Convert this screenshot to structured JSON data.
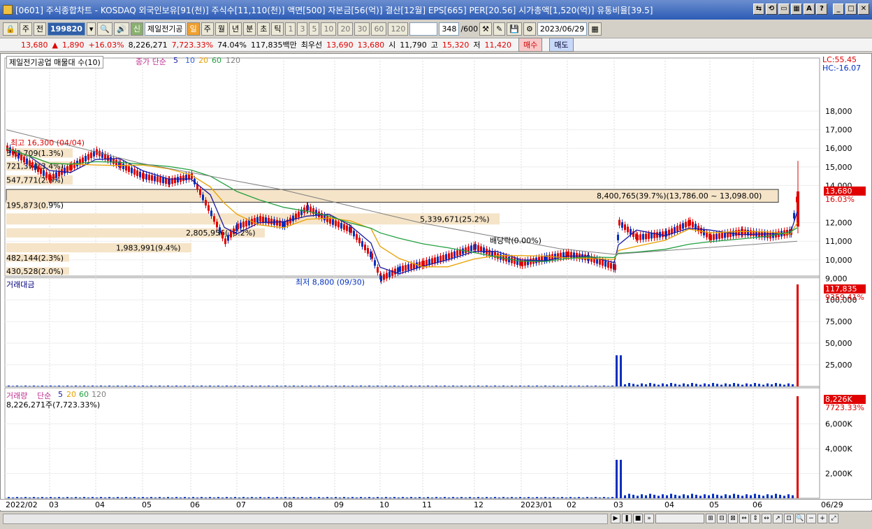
{
  "window": {
    "title": "[0601] 주식종합차트 - KOSDAQ 외국인보유[91(천)] 주식수[11,110(천)] 액면[500] 자본금[56(억)] 결산[12월] EPS[665] PER[20.56] 시가총액[1,520(억)] 유통비율[39.5]",
    "buttons": [
      "⇆",
      "⟲",
      "▭",
      "▦",
      "A",
      "?",
      "_",
      "□",
      "✕"
    ]
  },
  "toolbar": {
    "period_select": "주",
    "prev_label": "전",
    "code": "199820",
    "name_badge": "신",
    "stock_name": "제일전기공",
    "period_tabs": [
      "일",
      "주",
      "월",
      "년",
      "분",
      "초",
      "틱"
    ],
    "active_tab": "일",
    "intervals": [
      "1",
      "3",
      "5",
      "10",
      "20",
      "30",
      "60",
      "120"
    ],
    "count": "348",
    "count_total": "/600",
    "date": "2023/06/29"
  },
  "price_bar": {
    "price": "13,680",
    "arrow": "▲",
    "change": "1,890",
    "change_pct": "+16.03%",
    "volume": "8,226,271",
    "volume_pct": "7,723.33%",
    "turnover": "74.04%",
    "amount": "117,835백만",
    "bid_label": "최우선",
    "bid1": "13,690",
    "bid2": "13,680",
    "open_label": "시",
    "open": "11,790",
    "high_label": "고",
    "high": "15,320",
    "low_label": "저",
    "low": "11,420",
    "buy": "매수",
    "sell": "매도"
  },
  "price_panel": {
    "title": "제일전기공업 매물대 수(10)",
    "ma_label": "종가 단순",
    "ma_periods": [
      "5",
      "10",
      "20",
      "60",
      "120"
    ],
    "lc": "LC:55.45",
    "hc": "HC:-16.07",
    "y_ticks": [
      "18,000",
      "17,000",
      "16,000",
      "15,000",
      "14,000",
      "12,000",
      "11,000",
      "10,000",
      "9,000"
    ],
    "current_price_tag": "13,680",
    "current_pct_tag": "16.03%",
    "high_marker": "최고 16,300 (04/04)",
    "low_marker": "최저 8,800 (09/30)",
    "dividend_marker": "배당락(0.00%)",
    "volume_profile": [
      {
        "label": "8,400,765(39.7%)(13,786.00 ~ 13,098.00)"
      },
      {
        "label": "5,339,671(25.2%)"
      },
      {
        "label": "2,805,956(13.2%)"
      },
      {
        "label": "1,983,991(9.4%)"
      },
      {
        "label": "573,709(1.3%)"
      },
      {
        "label": "721,374(3.4%)"
      },
      {
        "label": "547,771(2.6%)"
      },
      {
        "label": "195,873(0.9%)"
      },
      {
        "label": "482,144(2.3%)"
      },
      {
        "label": "430,528(2.0%)"
      }
    ]
  },
  "amount_panel": {
    "title": "거래대금",
    "y_ticks": [
      "100,000",
      "75,000",
      "50,000",
      "25,000"
    ],
    "last_tag": "117,835",
    "last_pct": "9359.41%"
  },
  "volume_panel": {
    "title": "거래량",
    "ma_label": "단순",
    "ma_periods": [
      "5",
      "20",
      "60",
      "120"
    ],
    "value_line": "8,226,271주(7,723.33%)",
    "y_ticks": [
      "6,000K",
      "4,000K",
      "2,000K"
    ],
    "last_tag": "8,226K",
    "last_pct": "7723.33%"
  },
  "x_axis": [
    "2022/02",
    "03",
    "04",
    "05",
    "06",
    "07",
    "08",
    "09",
    "10",
    "11",
    "12",
    "2023/01",
    "02",
    "03",
    "04",
    "05",
    "06",
    "06/29"
  ],
  "colors": {
    "up": "#e00000",
    "down": "#0030c0",
    "ma5": "#1a1aa0",
    "ma20": "#e8a000",
    "ma60": "#22a040",
    "ma120": "#808080",
    "profile": "#f5e4c8"
  }
}
